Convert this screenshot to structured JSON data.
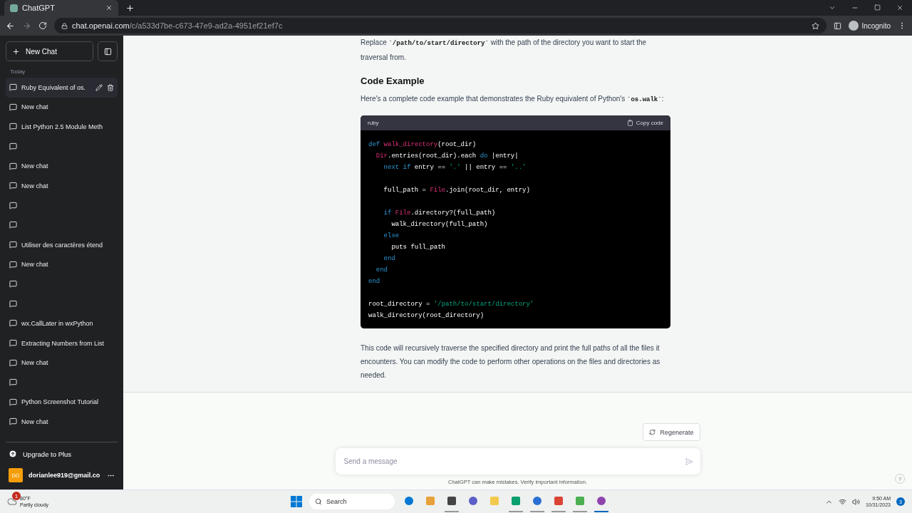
{
  "browser": {
    "tab_title": "ChatGPT",
    "url_host": "chat.openai.com",
    "url_path": "/c/a533d7be-c673-47e9-ad2a-4951ef21ef7c",
    "profile": "Incognito"
  },
  "sidebar": {
    "new_chat": "New Chat",
    "section": "Today",
    "items": [
      {
        "title": "Ruby Equivalent of os.",
        "selected": true
      },
      {
        "title": "New chat",
        "selected": false
      },
      {
        "title": "List Python 2.5 Module Meth",
        "selected": false
      },
      {
        "selected": false
      },
      {
        "title": "New chat",
        "selected": false
      },
      {
        "title": "New chat",
        "selected": false
      },
      {
        "selected": false
      },
      {
        "selected": false
      },
      {
        "title": "Utiliser des caractères étend",
        "selected": false
      },
      {
        "title": "New chat",
        "selected": false
      },
      {
        "selected": false
      },
      {
        "selected": false
      },
      {
        "title": "wx.CallLater in wxPython",
        "selected": false
      },
      {
        "title": "Extracting Numbers from List",
        "selected": false
      },
      {
        "title": "New chat",
        "selected": false
      },
      {
        "selected": false
      },
      {
        "title": "Python Screenshot Tutorial",
        "selected": false
      },
      {
        "title": "New chat",
        "selected": false
      }
    ],
    "upgrade": "Upgrade to Plus",
    "avatar": "DO",
    "email": "dorianlee919@gmail.co"
  },
  "message": {
    "intro": [
      {
        "kind": "text",
        "text": "Replace "
      },
      {
        "kind": "code",
        "text": "`/path/to/start/directory`"
      },
      {
        "kind": "text",
        "text": " with the path of the directory you want to start the traversal from."
      }
    ],
    "heading": "Code Example",
    "lead": [
      {
        "kind": "text",
        "text": "Here's a complete code example that demonstrates the Ruby equivalent of Python's "
      },
      {
        "kind": "code",
        "text": "`os.walk`"
      },
      {
        "kind": "text",
        "text": ":"
      }
    ],
    "code": {
      "language": "ruby",
      "copy": "Copy code",
      "lines": [
        {
          "kind": "code",
          "tokens": [
            {
              "kind": "kw",
              "text": "def"
            },
            {
              "kind": "name",
              "text": " walk_directory"
            },
            {
              "kind": "plain",
              "text": "(root_dir)"
            }
          ]
        },
        {
          "kind": "code",
          "tokens": [
            {
              "kind": "name",
              "text": "  Dir"
            },
            {
              "kind": "plain",
              "text": ".entries(root_dir).each "
            },
            {
              "kind": "kw",
              "text": "do"
            },
            {
              "kind": "plain",
              "text": " |entry|"
            }
          ]
        },
        {
          "kind": "code",
          "tokens": [
            {
              "kind": "kw",
              "text": "    next if"
            },
            {
              "kind": "plain",
              "text": " entry == "
            },
            {
              "kind": "str",
              "text": "'.'"
            },
            {
              "kind": "plain",
              "text": " || entry == "
            },
            {
              "kind": "str",
              "text": "'..'"
            }
          ]
        },
        {
          "kind": "blank"
        },
        {
          "kind": "code",
          "tokens": [
            {
              "kind": "plain",
              "text": "    full_path = "
            },
            {
              "kind": "name",
              "text": "File"
            },
            {
              "kind": "plain",
              "text": ".join(root_dir, entry)"
            }
          ]
        },
        {
          "kind": "blank"
        },
        {
          "kind": "code",
          "tokens": [
            {
              "kind": "kw",
              "text": "    if"
            },
            {
              "kind": "name",
              "text": " File"
            },
            {
              "kind": "plain",
              "text": ".directory?(full_path)"
            }
          ]
        },
        {
          "kind": "code",
          "tokens": [
            {
              "kind": "plain",
              "text": "      walk_directory(full_path)"
            }
          ]
        },
        {
          "kind": "code",
          "tokens": [
            {
              "kind": "kw",
              "text": "    else"
            }
          ]
        },
        {
          "kind": "code",
          "tokens": [
            {
              "kind": "plain",
              "text": "      puts full_path"
            }
          ]
        },
        {
          "kind": "code",
          "tokens": [
            {
              "kind": "kw",
              "text": "    end"
            }
          ]
        },
        {
          "kind": "code",
          "tokens": [
            {
              "kind": "kw",
              "text": "  end"
            }
          ]
        },
        {
          "kind": "code",
          "tokens": [
            {
              "kind": "kw",
              "text": "end"
            }
          ]
        },
        {
          "kind": "blank"
        },
        {
          "kind": "code",
          "tokens": [
            {
              "kind": "plain",
              "text": "root_directory = "
            },
            {
              "kind": "str",
              "text": "'/path/to/start/directory'"
            }
          ]
        },
        {
          "kind": "code",
          "tokens": [
            {
              "kind": "plain",
              "text": "walk_directory(root_directory)"
            }
          ]
        }
      ]
    },
    "outro": "This code will recursively traverse the specified directory and print the full paths of all the files it encounters. You can modify the code to perform other operations on the files and directories as needed."
  },
  "composer": {
    "regenerate": "Regenerate",
    "placeholder": "Send a message",
    "disclaimer": "ChatGPT can make mistakes. Verify important information.",
    "help": "?"
  },
  "taskbar": {
    "weather_badge": "1",
    "temperature": "80°F",
    "weather": "Partly cloudy",
    "search": "Search",
    "apps": [
      {
        "running": false,
        "selected": false
      },
      {
        "running": false,
        "selected": false
      },
      {
        "running": true,
        "selected": false
      },
      {
        "running": false,
        "selected": false
      },
      {
        "running": false,
        "selected": false
      },
      {
        "running": true,
        "selected": false
      },
      {
        "running": true,
        "selected": false
      },
      {
        "running": true,
        "selected": false
      },
      {
        "running": true,
        "selected": false
      },
      {
        "running": true,
        "selected": true
      }
    ],
    "time": "9:50 AM",
    "date": "10/31/2023",
    "notifications": "3"
  }
}
